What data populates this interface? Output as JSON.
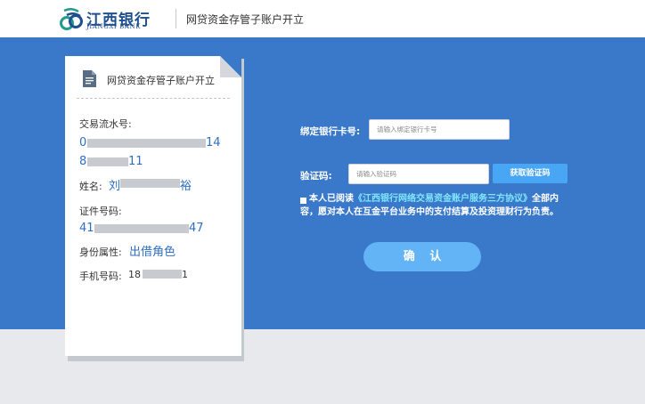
{
  "header": {
    "bank_name_cn": "江西银行",
    "bank_name_en": "JIANGXI BANK",
    "page_title": "网贷资金存管子账户开立",
    "logo_icon": "bank-logo-icon",
    "brand_color": "#1f4f8f"
  },
  "card": {
    "title": "网贷资金存管子账户开立",
    "icon": "document-icon",
    "fields": {
      "serial_label": "交易流水号:",
      "serial_line1_start": "0",
      "serial_line1_end": "14",
      "serial_line2_start": "8",
      "serial_line2_end": "11",
      "name_label": "姓名:",
      "name_start": "刘",
      "name_end": "裕",
      "id_label": "证件号码:",
      "id_start": "41",
      "id_end": "47",
      "attr_label": "身份属性:",
      "attr_value": "出借角色",
      "phone_label": "手机号码:",
      "phone_start": "18",
      "phone_end": "1"
    },
    "value_color": "#2f6fc2"
  },
  "form": {
    "card_label": "绑定银行卡号:",
    "card_placeholder": "请输入绑定银行卡号",
    "code_label": "验证码:",
    "code_placeholder": "请输入验证码",
    "sms_button": "获取验证码",
    "agreement_prefix": "本人已阅读",
    "agreement_link": "《江西银行网络交易资金账户服务三方协议》",
    "agreement_suffix": "全部内容，愿对本人在互金平台业务中的支付结算及投资理财行为负责。",
    "confirm_button": "确 认"
  },
  "colors": {
    "band": "#3a78c9",
    "button": "#49a6f5",
    "link": "#7fe7ff",
    "page_bg": "#e8e9ec"
  }
}
